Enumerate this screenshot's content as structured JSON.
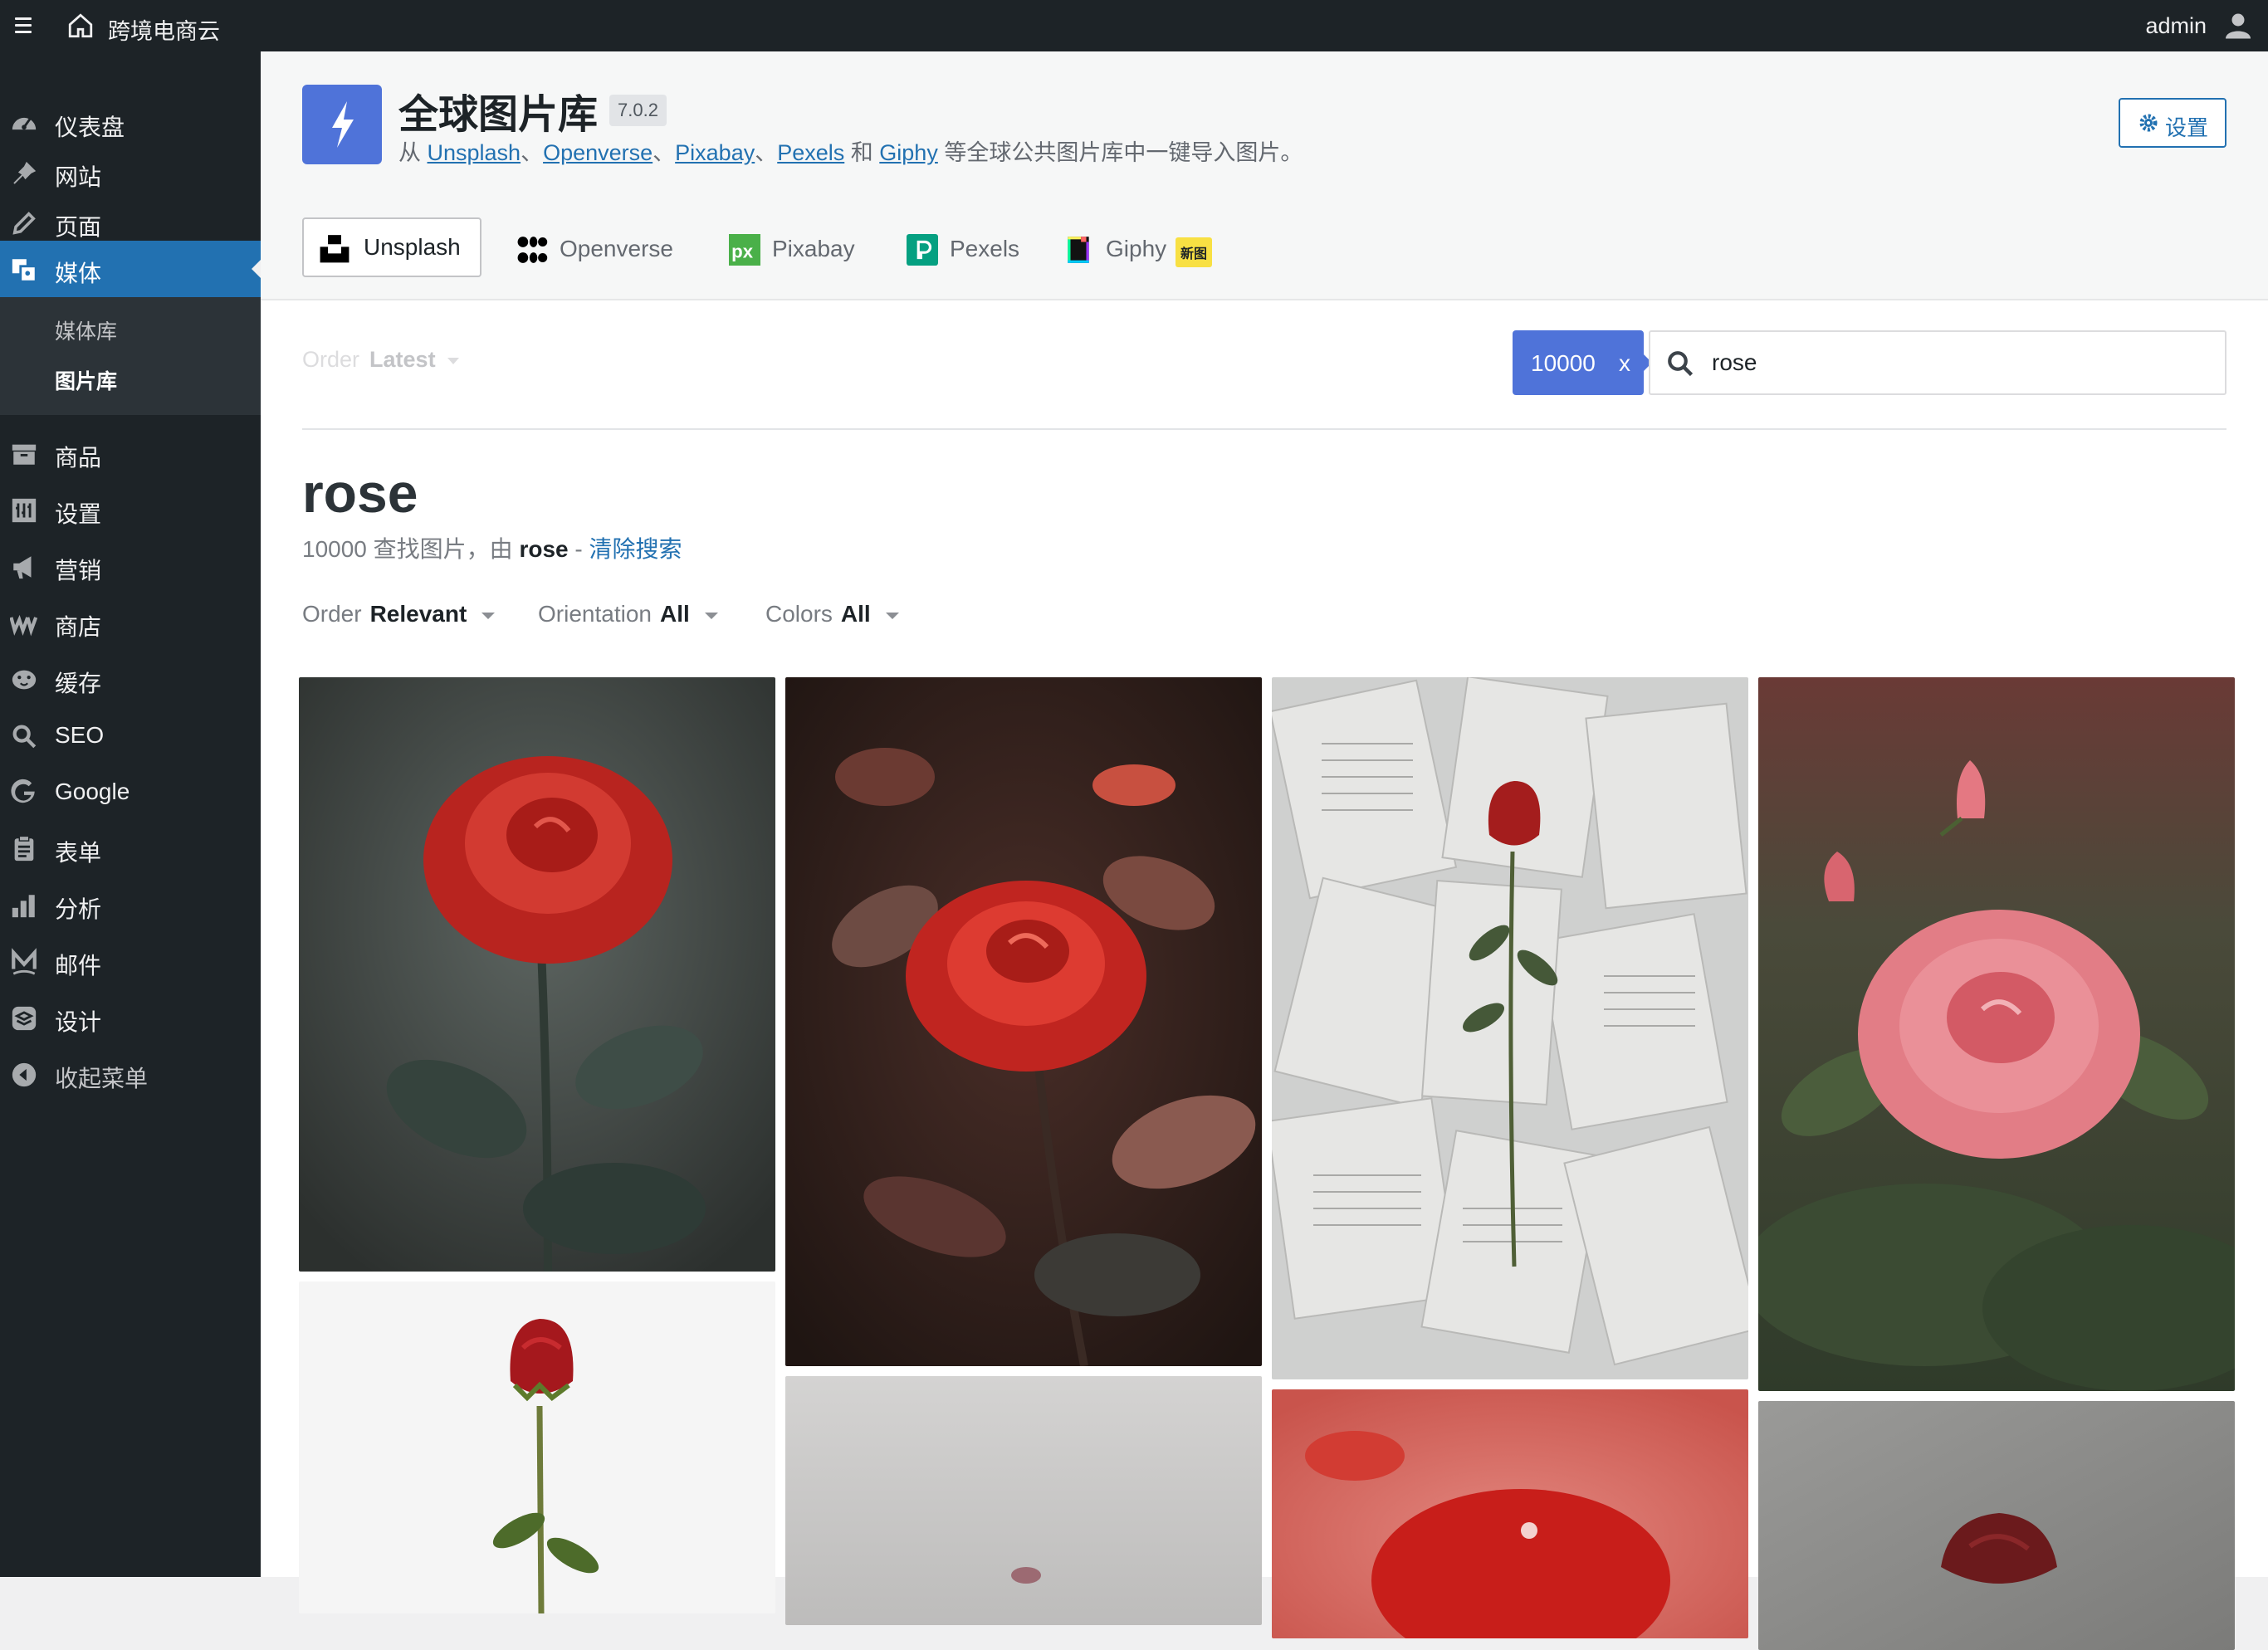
{
  "admin_bar": {
    "site_name": "跨境电商云",
    "user_name": "admin",
    "icons": [
      "menu-icon",
      "home-icon",
      "user-icon"
    ]
  },
  "sidebar": {
    "items": [
      {
        "label": "仪表盘",
        "icon": "dashboard-icon"
      },
      {
        "label": "网站",
        "icon": "pin-icon"
      },
      {
        "label": "页面",
        "icon": "pencil-icon"
      },
      {
        "label": "媒体",
        "icon": "media-icon",
        "active": true
      },
      {
        "label": "商品",
        "icon": "archive-icon"
      },
      {
        "label": "设置",
        "icon": "settings-icon"
      },
      {
        "label": "营销",
        "icon": "megaphone-icon"
      },
      {
        "label": "商店",
        "icon": "woo-icon"
      },
      {
        "label": "缓存",
        "icon": "cheetah-icon"
      },
      {
        "label": "SEO",
        "icon": "search-icon"
      },
      {
        "label": "Google",
        "icon": "google-icon"
      },
      {
        "label": "表单",
        "icon": "clipboard-icon"
      },
      {
        "label": "分析",
        "icon": "chart-icon"
      },
      {
        "label": "邮件",
        "icon": "mail-icon"
      },
      {
        "label": "设计",
        "icon": "layers-icon"
      },
      {
        "label": "收起菜单",
        "icon": "collapse-icon"
      }
    ],
    "submenu": [
      {
        "label": "媒体库"
      },
      {
        "label": "图片库",
        "current": true
      }
    ]
  },
  "header": {
    "title": "全球图片库",
    "version": "7.0.2",
    "subtitle_prefix": "从 ",
    "links": [
      "Unsplash",
      "Openverse",
      "Pixabay",
      "Pexels",
      "Giphy"
    ],
    "sep": "、",
    "and": " 和 ",
    "subtitle_suffix": " 等全球公共图片库中一键导入图片。",
    "settings_label": "设置"
  },
  "tabs": [
    {
      "label": "Unsplash",
      "icon": "unsplash-icon",
      "active": true
    },
    {
      "label": "Openverse",
      "icon": "openverse-icon"
    },
    {
      "label": "Pixabay",
      "icon": "pixabay-icon"
    },
    {
      "label": "Pexels",
      "icon": "pexels-icon"
    },
    {
      "label": "Giphy",
      "icon": "giphy-icon",
      "badge": "新图"
    }
  ],
  "search": {
    "order_label": "Order",
    "order_value": "Latest",
    "count": "10000",
    "clear_x": "x",
    "query": "rose"
  },
  "results": {
    "title": "rose",
    "count": "10000",
    "found_text": " 查找图片，由 ",
    "term": "rose",
    "dash": " - ",
    "clear_label": "清除搜索"
  },
  "filters": [
    {
      "label": "Order",
      "value": "Relevant"
    },
    {
      "label": "Orientation",
      "value": "All"
    },
    {
      "label": "Colors",
      "value": "All"
    }
  ],
  "colors": {
    "admin_bg": "#1d2327",
    "accent": "#2271b1",
    "brand": "#4f73d9"
  },
  "photos": [
    {
      "name": "red rose with dew",
      "bg": "#3d4340",
      "accent": "#c4312b"
    },
    {
      "name": "red rose dark background",
      "bg": "#2b1a17",
      "accent": "#d0302a"
    },
    {
      "name": "rose on book pages",
      "bg": "#d8d9d8",
      "accent": "#a41d1d"
    },
    {
      "name": "pink rose with raindrops",
      "bg": "#3e4c35",
      "accent": "#e27d86"
    },
    {
      "name": "single red rose white background",
      "bg": "#f4f4f4",
      "accent": "#a51d23"
    },
    {
      "name": "rose on grey background",
      "bg": "#c9c8c7",
      "accent": "#9c6a72"
    },
    {
      "name": "red petals close-up",
      "bg": "#d86a62",
      "accent": "#c81e1a"
    },
    {
      "name": "dark red rose grey backdrop",
      "bg": "#8d8d8b",
      "accent": "#6b1a1c"
    }
  ]
}
